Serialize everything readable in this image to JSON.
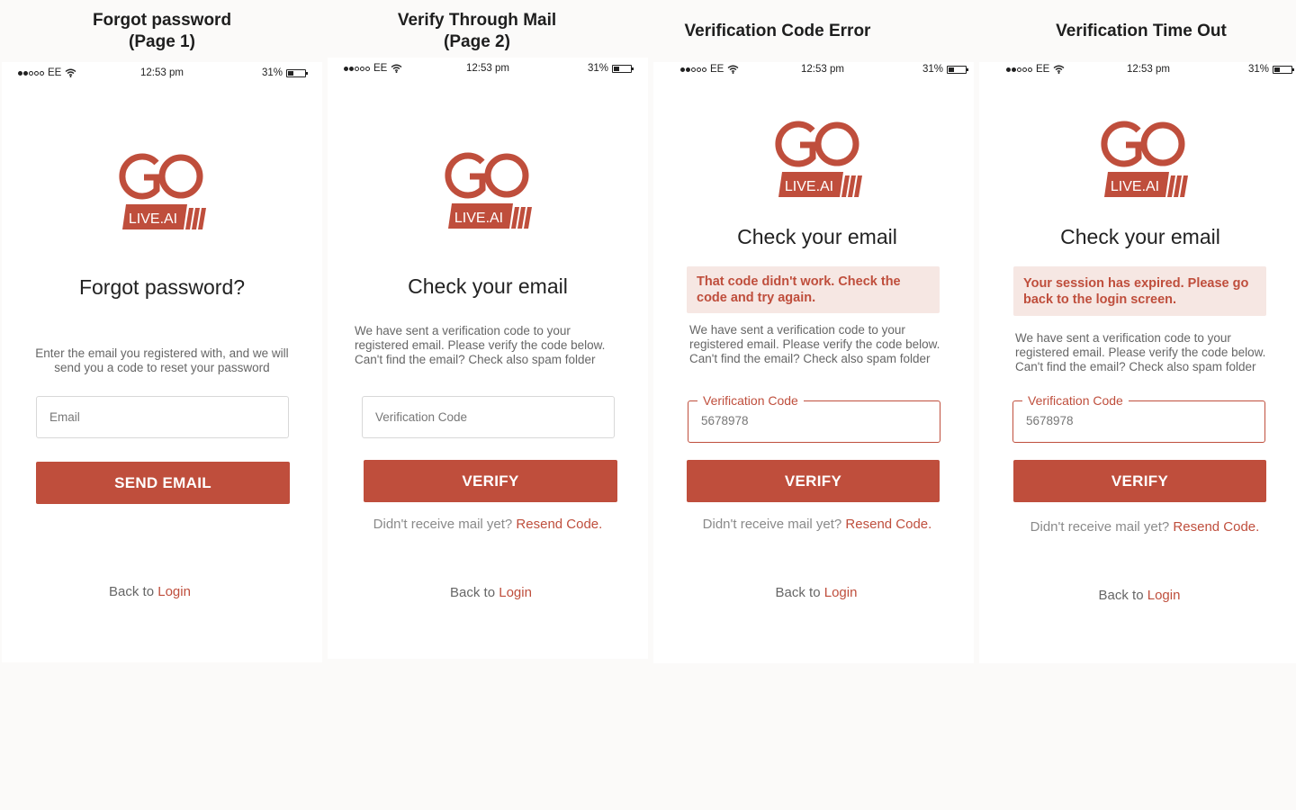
{
  "colors": {
    "accent": "#bf4e3c",
    "error_bg": "#f6e7e3"
  },
  "titles": [
    {
      "line1": "Forgot password",
      "line2": "(Page 1)"
    },
    {
      "line1": "Verify Through Mail",
      "line2": "(Page 2)"
    },
    {
      "line1": "Verification Code Error",
      "line2": ""
    },
    {
      "line1": "Verification Time Out",
      "line2": ""
    }
  ],
  "status": {
    "carrier": "EE",
    "time": "12:53 pm",
    "battery": "31%"
  },
  "logo": {
    "text": "LIVE.AI"
  },
  "screen1": {
    "heading": "Forgot password?",
    "desc": "Enter the email you registered with, and we will send you a code to reset your password",
    "email_placeholder": "Email",
    "button": "SEND EMAIL",
    "back_prefix": "Back to ",
    "back_link": "Login"
  },
  "screen2": {
    "heading": "Check your email",
    "desc": "We have sent a verification code to your registered email. Please verify the code below. Can't find the email? Check also spam folder",
    "code_placeholder": "Verification Code",
    "button": "VERIFY",
    "resend_prefix": "Didn't receive mail yet? ",
    "resend_link": "Resend Code.",
    "back_prefix": "Back to ",
    "back_link": "Login"
  },
  "screen3": {
    "heading": "Check your email",
    "error": "That code didn't work. Check the code and try again.",
    "desc": "We have sent a verification code to your registered email. Please verify the code below. Can't find the email? Check also spam folder",
    "code_label": "Verification Code",
    "code_value": "5678978",
    "button": "VERIFY",
    "resend_prefix": "Didn't receive mail yet? ",
    "resend_link": "Resend Code.",
    "back_prefix": "Back to ",
    "back_link": "Login"
  },
  "screen4": {
    "heading": "Check your email",
    "error": "Your session has expired. Please go back to the login screen.",
    "desc": "We have sent a verification code to your registered email. Please verify the code below. Can't find the email? Check also spam folder",
    "code_label": "Verification Code",
    "code_value": "5678978",
    "button": "VERIFY",
    "resend_prefix": "Didn't receive mail yet? ",
    "resend_link": "Resend Code.",
    "back_prefix": "Back to ",
    "back_link": "Login"
  }
}
